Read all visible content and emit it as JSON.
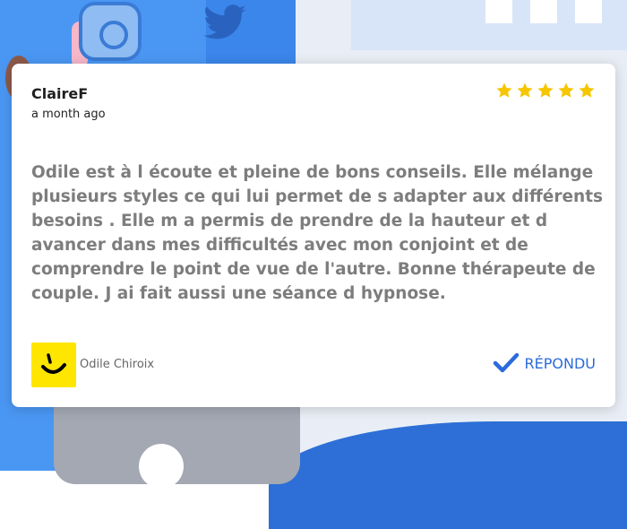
{
  "review": {
    "author": "ClaireF",
    "date": "a month ago",
    "rating": 5,
    "max_rating": 5,
    "text": "Odile est à l écoute et pleine de bons conseils. Elle mélange plusieurs styles ce qui lui permet de s adapter aux différents besoins . Elle m a permis de prendre de la hauteur et d avancer dans mes difficultés avec mon conjoint et de comprendre le point de vue de l'autre. Bonne thérapeute de couple. J ai fait aussi une séance d hypnose."
  },
  "reply": {
    "business_name": "Odile Chiroix",
    "logo_icon": "smiley-icon",
    "status_label": "RÉPONDU",
    "status_icon": "checkmark-icon"
  },
  "colors": {
    "star": "#f6c600",
    "accent": "#2b6bdc",
    "logo_bg": "#ffe600",
    "review_text": "#7d7d7d"
  }
}
